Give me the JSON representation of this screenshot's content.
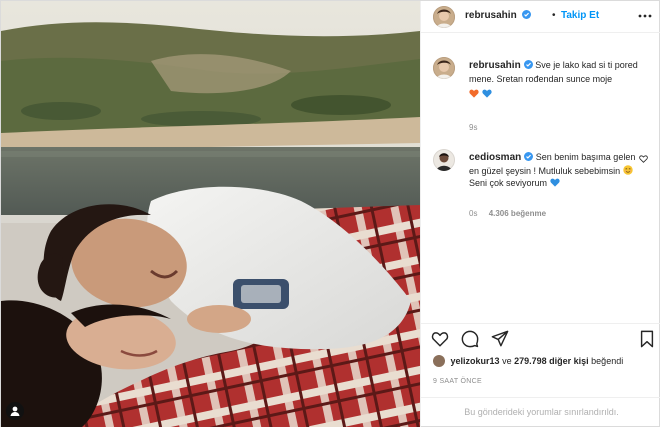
{
  "post": {
    "username": "rebrusahin",
    "follow_label": "Takip Et",
    "separator": "•",
    "photo_alt": "photo",
    "caption": {
      "username": "rebrusahin",
      "text": "Sve je lako kad si ti pored mene. Sretan rođendan sunce moje",
      "heart_colors": [
        "#f26b2a",
        "#2f8fe0"
      ],
      "time": "9s"
    },
    "comment": {
      "username": "cediosman",
      "text_part1": "Sen benim başıma gelen en güzel şeysin ! Mutluluk sebebimsin",
      "text_part2": "Seni çok seviyorum",
      "time": "0s",
      "likes": "4.306 beğenme"
    },
    "likes": {
      "liker": "yelizokur13",
      "connector": "ve",
      "count": "279.798 diğer kişi",
      "suffix": "beğendi"
    },
    "time_ago": "9 SAAT ÖNCE",
    "comments_restricted": "Bu gönderideki yorumlar sınırlandırıldı."
  },
  "icons": {
    "verified": "verified-badge-icon",
    "more": "more-options-icon",
    "like": "heart-outline-icon",
    "comment": "comment-bubble-icon",
    "share": "paper-plane-icon",
    "save": "bookmark-icon",
    "tag": "user-tag-icon"
  },
  "colors": {
    "accent": "#0095f6",
    "verified": "#3897f0",
    "muted": "#8e8e8e",
    "text": "#262626"
  }
}
